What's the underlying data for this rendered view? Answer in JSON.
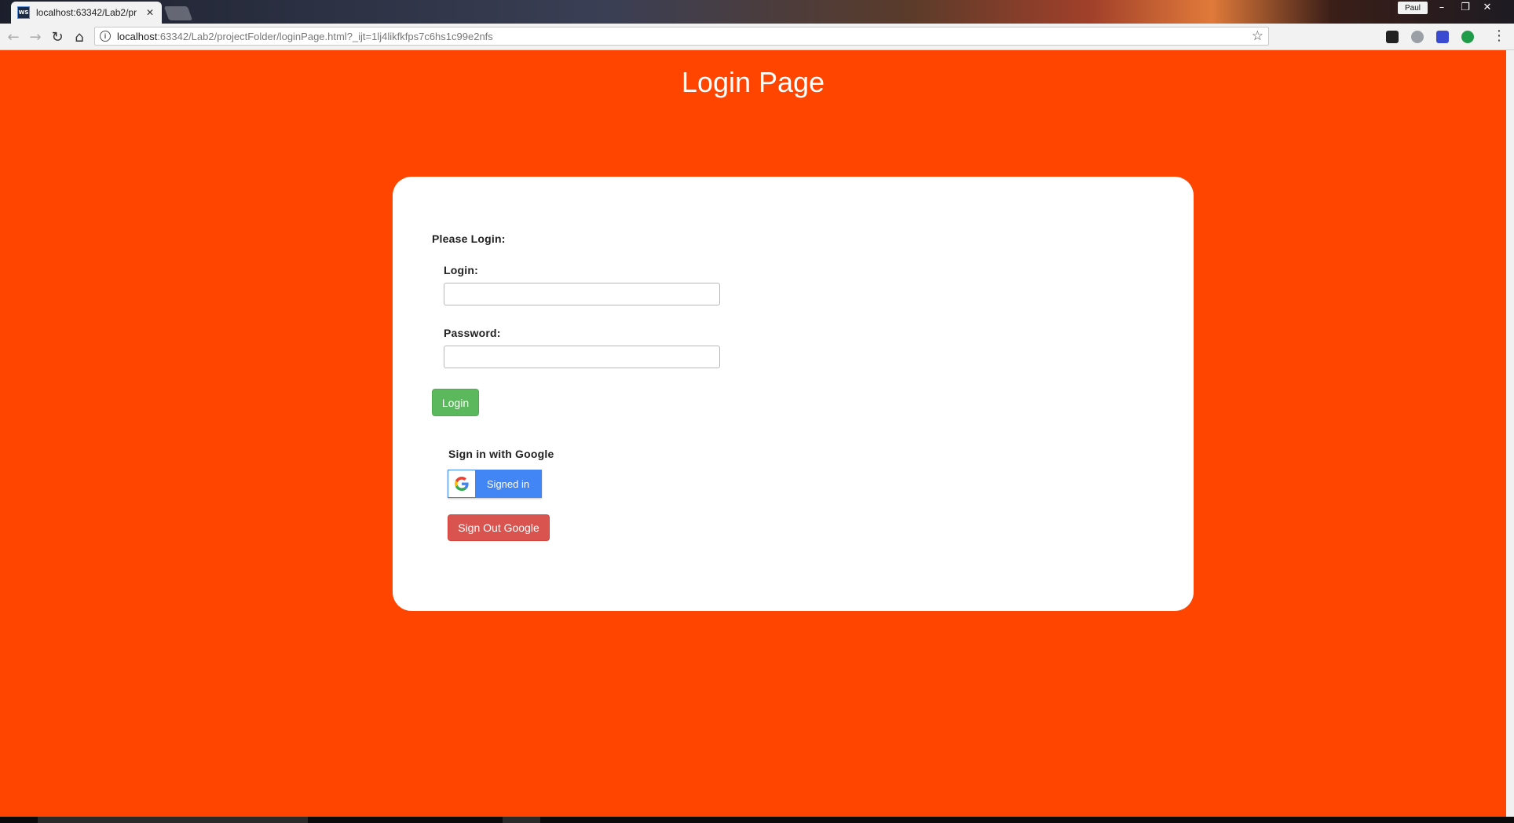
{
  "browser": {
    "tab_title": "localhost:63342/Lab2/pr",
    "favicon_text": "WS",
    "profile_name": "Paul",
    "url_host": "localhost",
    "url_rest": ":63342/Lab2/projectFolder/loginPage.html?_ijt=1lj4likfkfps7c6hs1c99e2nfs"
  },
  "page": {
    "title": "Login Page",
    "background_color": "#ff4500"
  },
  "form": {
    "heading": "Please Login:",
    "login_label": "Login:",
    "login_value": "",
    "password_label": "Password:",
    "password_value": "",
    "login_button": "Login",
    "google_heading": "Sign in with Google",
    "google_button": "Signed in",
    "signout_button": "Sign Out Google"
  },
  "colors": {
    "login_button": "#5cb85c",
    "google_button": "#4285f4",
    "signout_button": "#d9534f"
  }
}
